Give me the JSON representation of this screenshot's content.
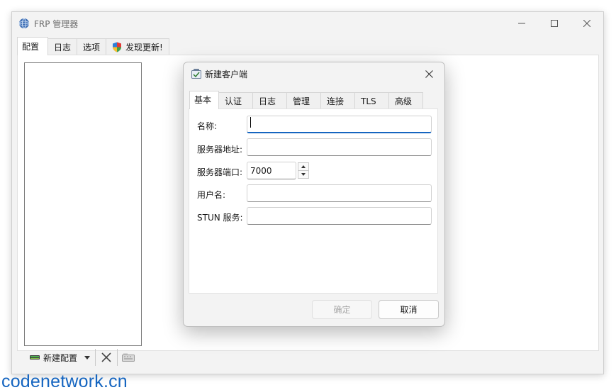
{
  "window": {
    "title": "FRP 管理器",
    "icon": "globe-icon",
    "controls": [
      "minimize-icon",
      "maximize-icon",
      "close-icon"
    ]
  },
  "main_tabs": [
    {
      "label": "配置",
      "active": true
    },
    {
      "label": "日志",
      "active": false
    },
    {
      "label": "选项",
      "active": false
    },
    {
      "label": "发现更新!",
      "active": false,
      "icon": "shield-icon"
    }
  ],
  "toolbar": {
    "new_label": "新建配置",
    "icons": [
      "new-config-icon",
      "dropdown-arrow-icon",
      "delete-icon",
      "keyboard-icon"
    ]
  },
  "dialog": {
    "title": "新建客户端",
    "icon": "client-icon",
    "tabs": [
      {
        "label": "基本",
        "active": true
      },
      {
        "label": "认证",
        "active": false
      },
      {
        "label": "日志",
        "active": false
      },
      {
        "label": "管理",
        "active": false
      },
      {
        "label": "连接",
        "active": false
      },
      {
        "label": "TLS",
        "active": false
      },
      {
        "label": "高级",
        "active": false
      }
    ],
    "fields": {
      "name_label": "名称:",
      "name_value": "",
      "server_addr_label": "服务器地址:",
      "server_addr_value": "",
      "server_port_label": "服务器端口:",
      "server_port_value": "7000",
      "user_label": "用户名:",
      "user_value": "",
      "stun_label": "STUN 服务:",
      "stun_value": ""
    },
    "ok_label": "确定",
    "cancel_label": "取消"
  },
  "watermark": "codenetwork.cn",
  "colors": {
    "accent": "#1565c0",
    "window_bg": "#f3f3f3",
    "panel_bg": "#ffffff"
  }
}
